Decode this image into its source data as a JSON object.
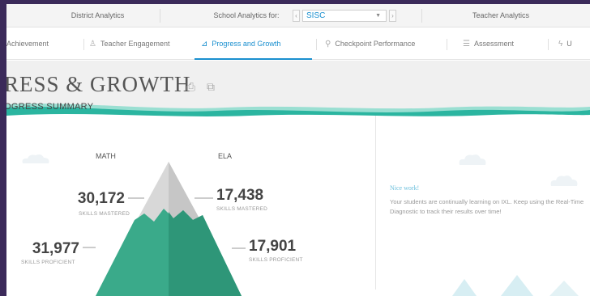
{
  "topnav": {
    "district": "District Analytics",
    "school_label": "School Analytics for:",
    "school_value": "SISC",
    "teacher": "Teacher Analytics"
  },
  "tabs": [
    {
      "label": "Achievement",
      "icon": "achievement-icon"
    },
    {
      "label": "Teacher Engagement",
      "icon": "teacher-icon"
    },
    {
      "label": "Progress and Growth",
      "icon": "growth-chart-icon",
      "active": true
    },
    {
      "label": "Checkpoint Performance",
      "icon": "checkpoint-icon"
    },
    {
      "label": "Assessment",
      "icon": "assessment-icon"
    },
    {
      "label": "U",
      "icon": "usage-icon"
    }
  ],
  "header": {
    "title": "RESS & GROWTH",
    "print_icon": "print-icon",
    "export_icon": "export-icon"
  },
  "summary": {
    "title": "OGRESS SUMMARY",
    "math": {
      "label": "MATH",
      "mastered_value": "30,172",
      "mastered_label": "SKILLS MASTERED",
      "proficient_value": "31,977",
      "proficient_label": "SKILLS PROFICIENT"
    },
    "ela": {
      "label": "ELA",
      "mastered_value": "17,438",
      "mastered_label": "SKILLS MASTERED",
      "proficient_value": "17,901",
      "proficient_label": "SKILLS PROFICIENT"
    }
  },
  "message": {
    "title": "Nice work!",
    "body": "Your students are continually learning on IXL. Keep using the Real-Time Diagnostic to track their results over time!"
  },
  "colors": {
    "accent": "#1a8fcf",
    "mountain": "#3aaa8a",
    "wave": "#2bb5a0"
  }
}
